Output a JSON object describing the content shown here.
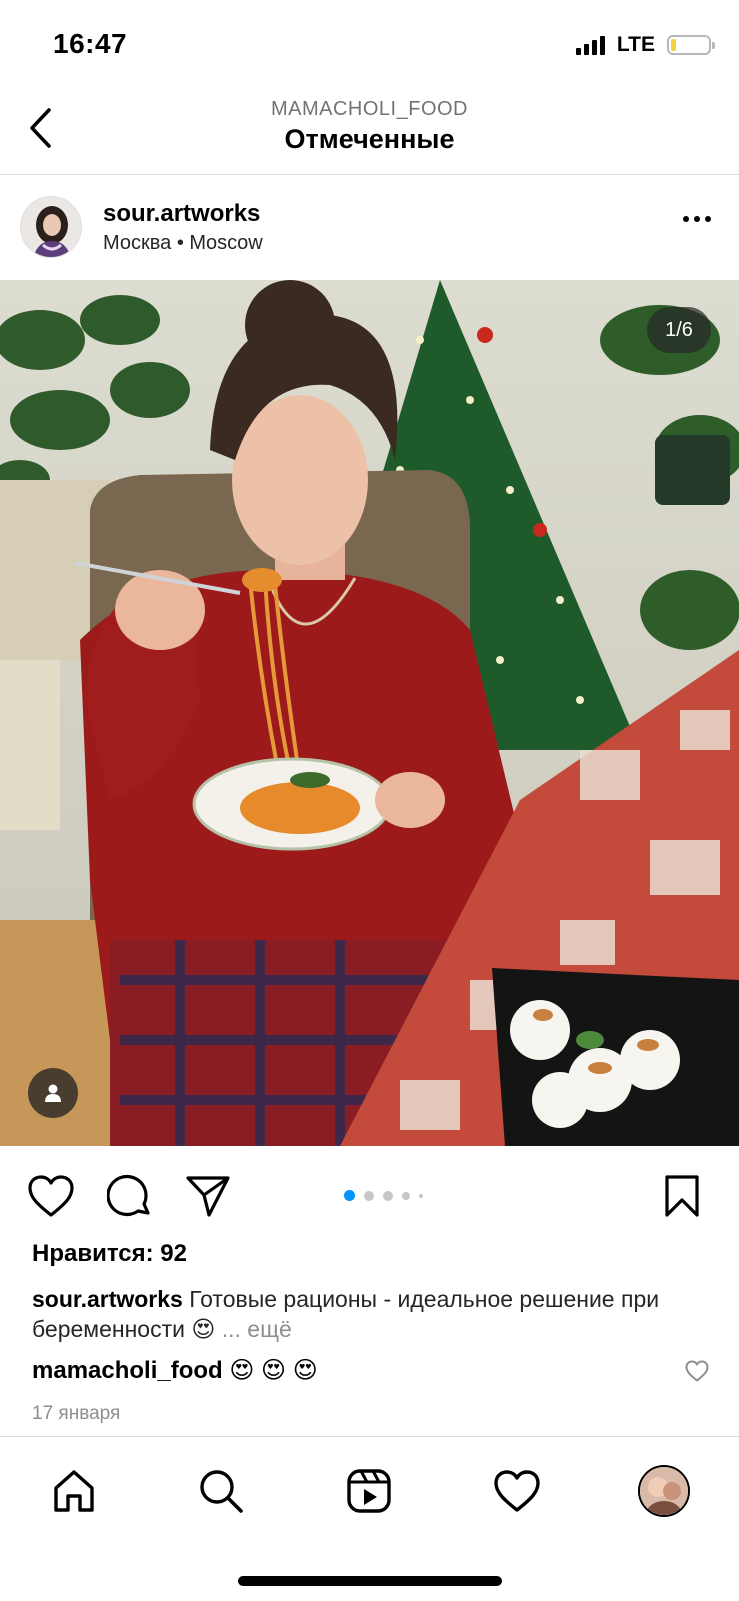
{
  "status": {
    "time": "16:47",
    "network": "LTE",
    "battery_color": "#f4d23a"
  },
  "header": {
    "account": "MAMACHOLI_FOOD",
    "title": "Отмеченные"
  },
  "post": {
    "username": "sour.artworks",
    "location": "Москва • Moscow",
    "counter": "1/6",
    "likes": "Нравится: 92",
    "caption_user": "sour.artworks",
    "caption_text": " Готовые рационы - идеальное решение при беременности 😍",
    "caption_more": " ... ещё",
    "comment_user": "mamacholi_food",
    "comment_text": " 😍 😍 😍",
    "date": "17 января"
  },
  "icons": {
    "back": "chevron-left-icon",
    "more": "more-horizontal-icon",
    "tag": "user-tag-icon",
    "like": "heart-icon",
    "comment": "comment-icon",
    "share": "send-icon",
    "save": "bookmark-icon",
    "tabs": [
      "home-icon",
      "search-icon",
      "reels-icon",
      "activity-heart-icon",
      "profile-avatar"
    ]
  },
  "carousel": {
    "total": 5,
    "active": 1
  },
  "accent_color": "#0095f6"
}
